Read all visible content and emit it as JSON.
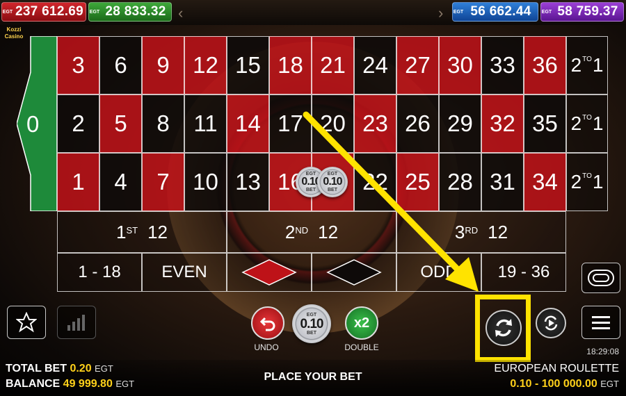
{
  "jackpots": [
    {
      "egt": "EGT",
      "value": "237 612.69",
      "color": "red"
    },
    {
      "egt": "EGT",
      "value": "28 833.32",
      "color": "green"
    },
    {
      "egt": "EGT",
      "value": "56 662.44",
      "color": "blue"
    },
    {
      "egt": "EGT",
      "value": "58 759.37",
      "color": "purple"
    }
  ],
  "logo": "Kozzi Casino",
  "zero": "0",
  "numbers": {
    "row_top": [
      "3",
      "6",
      "9",
      "12",
      "15",
      "18",
      "21",
      "24",
      "27",
      "30",
      "33",
      "36"
    ],
    "row_mid": [
      "2",
      "5",
      "8",
      "11",
      "14",
      "17",
      "20",
      "23",
      "26",
      "29",
      "32",
      "35"
    ],
    "row_bot": [
      "1",
      "4",
      "7",
      "10",
      "13",
      "16",
      "19",
      "22",
      "25",
      "28",
      "31",
      "34"
    ]
  },
  "column_bet": {
    "a": "2",
    "to": "TO",
    "b": "1"
  },
  "dozens": [
    {
      "ord": "1",
      "sup": "ST",
      "num": "12"
    },
    {
      "ord": "2",
      "sup": "ND",
      "num": "12"
    },
    {
      "ord": "3",
      "sup": "RD",
      "num": "12"
    }
  ],
  "outside": {
    "low": "1 - 18",
    "even": "EVEN",
    "odd": "ODD",
    "high": "19 - 36"
  },
  "chips": {
    "egt": "EGT",
    "value": "0.10",
    "bet": "BET"
  },
  "controls": {
    "undo": "UNDO",
    "double": "DOUBLE",
    "double_icon": "x2"
  },
  "clock": "18:29:08",
  "status": "PLACE YOUR BET",
  "total_bet": {
    "label": "TOTAL BET",
    "value": "0.20",
    "unit": "EGT"
  },
  "balance": {
    "label": "BALANCE",
    "value": "49 999.80",
    "unit": "EGT"
  },
  "game_name": "EUROPEAN ROULETTE",
  "limits": {
    "value": "0.10 - 100 000.00",
    "unit": "EGT"
  },
  "colors": {
    "red": "#be1218",
    "black": "#0e0a09",
    "green": "#1e8a3a",
    "highlight": "#ffe300"
  }
}
